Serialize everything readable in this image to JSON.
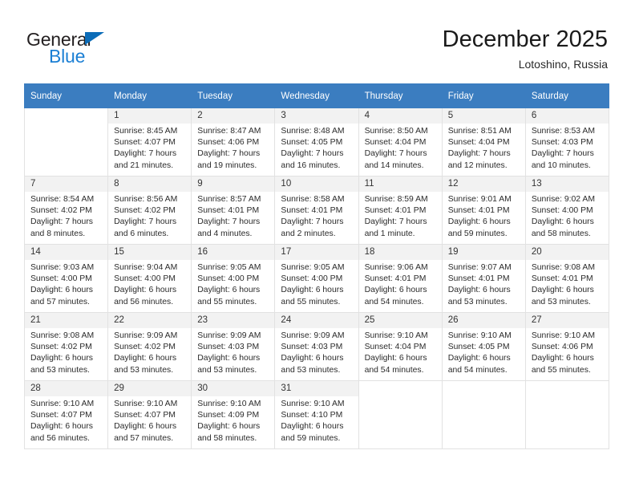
{
  "brand": {
    "name_part1": "General",
    "name_part2": "Blue",
    "accent_color": "#1b7fd4",
    "triangle_color": "#0b6cb8"
  },
  "header": {
    "title": "December 2025",
    "subtitle": "Lotoshino, Russia"
  },
  "calendar": {
    "header_color": "#3b7dc0",
    "weekdays": [
      "Sunday",
      "Monday",
      "Tuesday",
      "Wednesday",
      "Thursday",
      "Friday",
      "Saturday"
    ],
    "weeks": [
      [
        {
          "day": "",
          "sunrise": "",
          "sunset": "",
          "daylight": "",
          "empty": true
        },
        {
          "day": "1",
          "sunrise": "Sunrise: 8:45 AM",
          "sunset": "Sunset: 4:07 PM",
          "daylight": "Daylight: 7 hours and 21 minutes."
        },
        {
          "day": "2",
          "sunrise": "Sunrise: 8:47 AM",
          "sunset": "Sunset: 4:06 PM",
          "daylight": "Daylight: 7 hours and 19 minutes."
        },
        {
          "day": "3",
          "sunrise": "Sunrise: 8:48 AM",
          "sunset": "Sunset: 4:05 PM",
          "daylight": "Daylight: 7 hours and 16 minutes."
        },
        {
          "day": "4",
          "sunrise": "Sunrise: 8:50 AM",
          "sunset": "Sunset: 4:04 PM",
          "daylight": "Daylight: 7 hours and 14 minutes."
        },
        {
          "day": "5",
          "sunrise": "Sunrise: 8:51 AM",
          "sunset": "Sunset: 4:04 PM",
          "daylight": "Daylight: 7 hours and 12 minutes."
        },
        {
          "day": "6",
          "sunrise": "Sunrise: 8:53 AM",
          "sunset": "Sunset: 4:03 PM",
          "daylight": "Daylight: 7 hours and 10 minutes."
        }
      ],
      [
        {
          "day": "7",
          "sunrise": "Sunrise: 8:54 AM",
          "sunset": "Sunset: 4:02 PM",
          "daylight": "Daylight: 7 hours and 8 minutes."
        },
        {
          "day": "8",
          "sunrise": "Sunrise: 8:56 AM",
          "sunset": "Sunset: 4:02 PM",
          "daylight": "Daylight: 7 hours and 6 minutes."
        },
        {
          "day": "9",
          "sunrise": "Sunrise: 8:57 AM",
          "sunset": "Sunset: 4:01 PM",
          "daylight": "Daylight: 7 hours and 4 minutes."
        },
        {
          "day": "10",
          "sunrise": "Sunrise: 8:58 AM",
          "sunset": "Sunset: 4:01 PM",
          "daylight": "Daylight: 7 hours and 2 minutes."
        },
        {
          "day": "11",
          "sunrise": "Sunrise: 8:59 AM",
          "sunset": "Sunset: 4:01 PM",
          "daylight": "Daylight: 7 hours and 1 minute."
        },
        {
          "day": "12",
          "sunrise": "Sunrise: 9:01 AM",
          "sunset": "Sunset: 4:01 PM",
          "daylight": "Daylight: 6 hours and 59 minutes."
        },
        {
          "day": "13",
          "sunrise": "Sunrise: 9:02 AM",
          "sunset": "Sunset: 4:00 PM",
          "daylight": "Daylight: 6 hours and 58 minutes."
        }
      ],
      [
        {
          "day": "14",
          "sunrise": "Sunrise: 9:03 AM",
          "sunset": "Sunset: 4:00 PM",
          "daylight": "Daylight: 6 hours and 57 minutes."
        },
        {
          "day": "15",
          "sunrise": "Sunrise: 9:04 AM",
          "sunset": "Sunset: 4:00 PM",
          "daylight": "Daylight: 6 hours and 56 minutes."
        },
        {
          "day": "16",
          "sunrise": "Sunrise: 9:05 AM",
          "sunset": "Sunset: 4:00 PM",
          "daylight": "Daylight: 6 hours and 55 minutes."
        },
        {
          "day": "17",
          "sunrise": "Sunrise: 9:05 AM",
          "sunset": "Sunset: 4:00 PM",
          "daylight": "Daylight: 6 hours and 55 minutes."
        },
        {
          "day": "18",
          "sunrise": "Sunrise: 9:06 AM",
          "sunset": "Sunset: 4:01 PM",
          "daylight": "Daylight: 6 hours and 54 minutes."
        },
        {
          "day": "19",
          "sunrise": "Sunrise: 9:07 AM",
          "sunset": "Sunset: 4:01 PM",
          "daylight": "Daylight: 6 hours and 53 minutes."
        },
        {
          "day": "20",
          "sunrise": "Sunrise: 9:08 AM",
          "sunset": "Sunset: 4:01 PM",
          "daylight": "Daylight: 6 hours and 53 minutes."
        }
      ],
      [
        {
          "day": "21",
          "sunrise": "Sunrise: 9:08 AM",
          "sunset": "Sunset: 4:02 PM",
          "daylight": "Daylight: 6 hours and 53 minutes."
        },
        {
          "day": "22",
          "sunrise": "Sunrise: 9:09 AM",
          "sunset": "Sunset: 4:02 PM",
          "daylight": "Daylight: 6 hours and 53 minutes."
        },
        {
          "day": "23",
          "sunrise": "Sunrise: 9:09 AM",
          "sunset": "Sunset: 4:03 PM",
          "daylight": "Daylight: 6 hours and 53 minutes."
        },
        {
          "day": "24",
          "sunrise": "Sunrise: 9:09 AM",
          "sunset": "Sunset: 4:03 PM",
          "daylight": "Daylight: 6 hours and 53 minutes."
        },
        {
          "day": "25",
          "sunrise": "Sunrise: 9:10 AM",
          "sunset": "Sunset: 4:04 PM",
          "daylight": "Daylight: 6 hours and 54 minutes."
        },
        {
          "day": "26",
          "sunrise": "Sunrise: 9:10 AM",
          "sunset": "Sunset: 4:05 PM",
          "daylight": "Daylight: 6 hours and 54 minutes."
        },
        {
          "day": "27",
          "sunrise": "Sunrise: 9:10 AM",
          "sunset": "Sunset: 4:06 PM",
          "daylight": "Daylight: 6 hours and 55 minutes."
        }
      ],
      [
        {
          "day": "28",
          "sunrise": "Sunrise: 9:10 AM",
          "sunset": "Sunset: 4:07 PM",
          "daylight": "Daylight: 6 hours and 56 minutes."
        },
        {
          "day": "29",
          "sunrise": "Sunrise: 9:10 AM",
          "sunset": "Sunset: 4:07 PM",
          "daylight": "Daylight: 6 hours and 57 minutes."
        },
        {
          "day": "30",
          "sunrise": "Sunrise: 9:10 AM",
          "sunset": "Sunset: 4:09 PM",
          "daylight": "Daylight: 6 hours and 58 minutes."
        },
        {
          "day": "31",
          "sunrise": "Sunrise: 9:10 AM",
          "sunset": "Sunset: 4:10 PM",
          "daylight": "Daylight: 6 hours and 59 minutes."
        },
        {
          "day": "",
          "sunrise": "",
          "sunset": "",
          "daylight": "",
          "empty": true
        },
        {
          "day": "",
          "sunrise": "",
          "sunset": "",
          "daylight": "",
          "empty": true
        },
        {
          "day": "",
          "sunrise": "",
          "sunset": "",
          "daylight": "",
          "empty": true
        }
      ]
    ]
  }
}
